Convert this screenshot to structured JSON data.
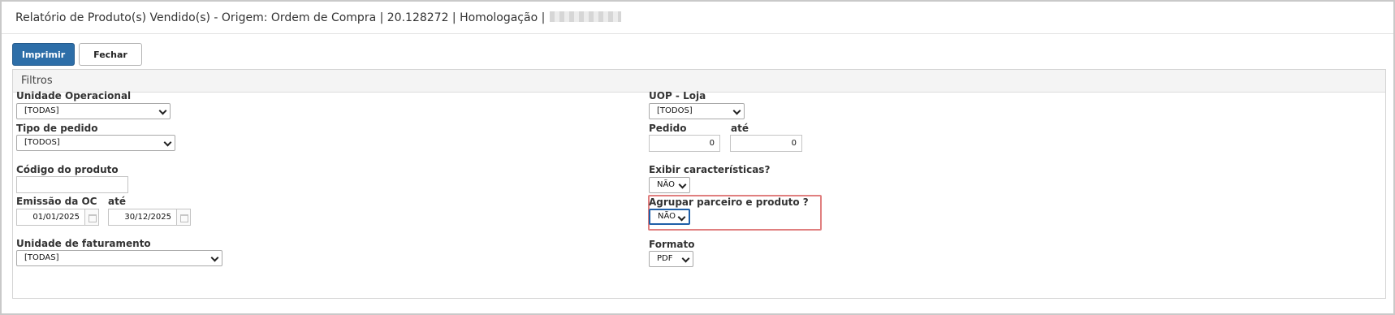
{
  "title": {
    "text": "Relatório de Produto(s) Vendido(s) - Origem: Ordem de Compra | 20.128272 | Homologação |"
  },
  "toolbar": {
    "print_label": "Imprimir",
    "close_label": "Fechar"
  },
  "filters": {
    "heading": "Filtros",
    "unidade_operacional": {
      "label": "Unidade Operacional",
      "value": "[TODAS]"
    },
    "tipo_pedido": {
      "label": "Tipo de pedido",
      "value": "[TODOS]"
    },
    "codigo_produto": {
      "label": "Código do produto",
      "value": ""
    },
    "emissao_oc": {
      "label": "Emissão da OC",
      "ate_label": "até",
      "from": "01/01/2025",
      "to": "30/12/2025"
    },
    "unidade_faturamento": {
      "label": "Unidade de faturamento",
      "value": "[TODAS]"
    },
    "uop_loja": {
      "label": "UOP - Loja",
      "value": "[TODOS]"
    },
    "pedido": {
      "label": "Pedido",
      "ate_label": "até",
      "from": "0",
      "to": "0"
    },
    "exibir_caracteristicas": {
      "label": "Exibir características?",
      "value": "NÃO"
    },
    "agrupar_parceiro": {
      "label": "Agrupar parceiro e produto ?",
      "value": "NÃO"
    },
    "formato": {
      "label": "Formato",
      "value": "PDF"
    }
  },
  "colors": {
    "primary": "#2d6ea8",
    "highlight": "#e07f7f",
    "focus": "#1f5fa8"
  }
}
